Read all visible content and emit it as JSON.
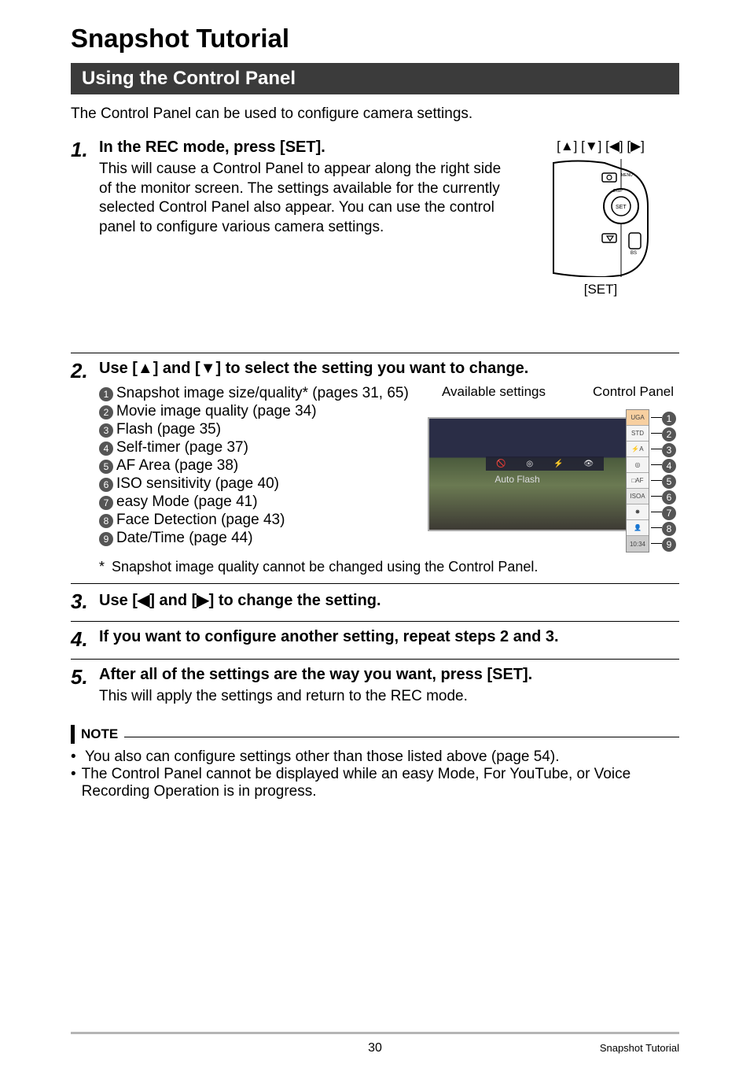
{
  "title": "Snapshot Tutorial",
  "section_heading": "Using the Control Panel",
  "intro": "The Control Panel can be used to configure camera settings.",
  "camera_fig": {
    "top_label": "[▲] [▼] [◀] [▶]",
    "bottom_label": "[SET]"
  },
  "steps": [
    {
      "num": "1.",
      "title": "In the REC mode, press [SET].",
      "body": "This will cause a Control Panel to appear along the right side of the monitor screen. The settings available for the currently selected Control Panel also appear. You can use the control panel to configure various camera settings."
    },
    {
      "num": "2.",
      "title": "Use [▲] and [▼] to select the setting you want to change."
    },
    {
      "num": "3.",
      "title": "Use [◀] and [▶] to change the setting."
    },
    {
      "num": "4.",
      "title": "If you want to configure another setting, repeat steps 2 and 3."
    },
    {
      "num": "5.",
      "title": "After all of the settings are the way you want, press [SET].",
      "body": "This will apply the settings and return to the REC mode."
    }
  ],
  "settings_fig": {
    "label_available": "Available settings",
    "label_panel": "Control Panel",
    "screen_caption": "Auto Flash",
    "bar_icons": [
      "🚫",
      "◎",
      "⚡",
      "👁"
    ],
    "cells": [
      "UGA",
      "STD",
      "⚡A",
      "◎",
      "□AF",
      "ISOA",
      "✸",
      "👤",
      "10:34"
    ]
  },
  "settings_list": [
    {
      "n": "1",
      "text": "Snapshot image size/quality* (pages 31, 65)"
    },
    {
      "n": "2",
      "text": "Movie image quality (page 34)"
    },
    {
      "n": "3",
      "text": "Flash (page 35)"
    },
    {
      "n": "4",
      "text": "Self-timer (page 37)"
    },
    {
      "n": "5",
      "text": "AF Area (page 38)"
    },
    {
      "n": "6",
      "text": "ISO sensitivity (page 40)"
    },
    {
      "n": "7",
      "text": "easy Mode (page 41)"
    },
    {
      "n": "8",
      "text": "Face Detection (page 43)"
    },
    {
      "n": "9",
      "text": "Date/Time (page 44)"
    }
  ],
  "footnote": "Snapshot image quality cannot be changed using the Control Panel.",
  "note": {
    "heading": "NOTE",
    "items": [
      "You also can configure settings other than those listed above (page 54).",
      "The Control Panel cannot be displayed while an easy Mode, For YouTube, or Voice Recording Operation is in progress."
    ]
  },
  "footer": {
    "page_number": "30",
    "footer_title": "Snapshot Tutorial"
  }
}
